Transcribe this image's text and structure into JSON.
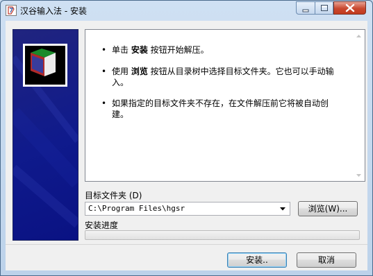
{
  "window": {
    "title": "汉谷输入法 - 安装"
  },
  "instructions": {
    "items": [
      {
        "prefix": "单击 ",
        "keyword": "安装",
        "suffix": " 按钮开始解压。"
      },
      {
        "prefix": "使用 ",
        "keyword": "浏览",
        "suffix": " 按钮从目录树中选择目标文件夹。它也可以手动输入。"
      },
      {
        "prefix": "",
        "keyword": "",
        "suffix": "如果指定的目标文件夹不存在，在文件解压前它将被自动创建。"
      }
    ]
  },
  "destination": {
    "label": "目标文件夹 (D)",
    "value": "C:\\Program Files\\hgsr",
    "browse_label": "浏览(W)..."
  },
  "progress": {
    "label": "安装进度",
    "value": 0
  },
  "buttons": {
    "install_label": "安装..",
    "cancel_label": "取消"
  },
  "icons": {
    "app": "app-installer-icon",
    "banner": "3d-box-logo-icon",
    "minimize": "minimize-icon",
    "maximize": "maximize-icon",
    "close": "close-icon",
    "combo": "chevron-down-icon"
  },
  "colors": {
    "banner": "#12198a",
    "close_button": "#c8482f",
    "progress_fill": "#37b44a"
  }
}
